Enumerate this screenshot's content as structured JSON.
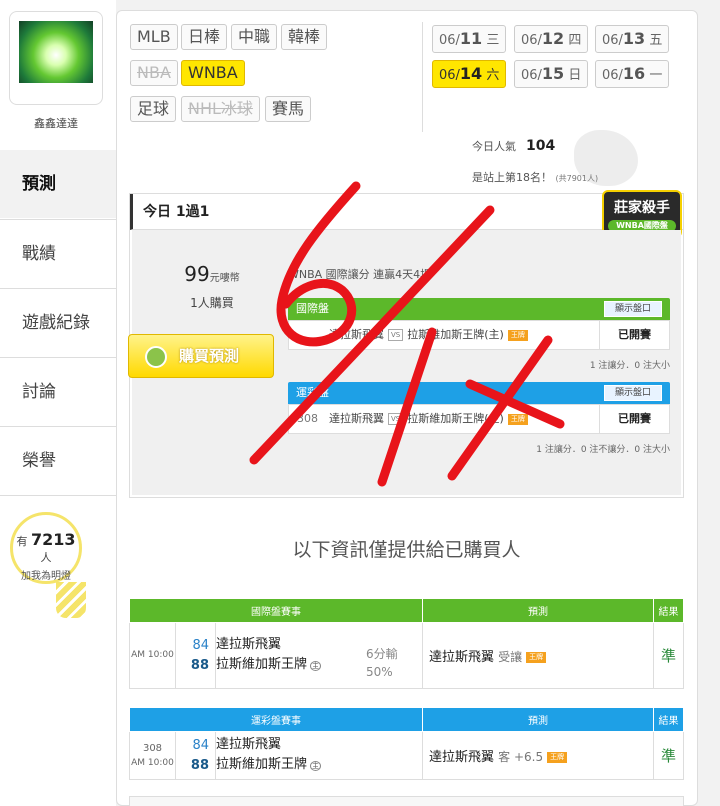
{
  "user": {
    "name": "鑫鑫達達"
  },
  "nav": [
    {
      "label": "預測",
      "active": true
    },
    {
      "label": "戰績"
    },
    {
      "label": "遊戲紀錄"
    },
    {
      "label": "討論"
    },
    {
      "label": "榮譽"
    }
  ],
  "fans": {
    "prefix": "有",
    "count": "7213",
    "suffix": "人",
    "line2": "加我為明燈"
  },
  "leagues": [
    "MLB",
    "日棒",
    "中職",
    "韓棒",
    "NBA",
    "WNBA",
    "足球",
    "NHL冰球",
    "賽馬"
  ],
  "dates": [
    {
      "date": "06/",
      "day": "11",
      "wd": "三"
    },
    {
      "date": "06/",
      "day": "12",
      "wd": "四"
    },
    {
      "date": "06/",
      "day": "13",
      "wd": "五"
    },
    {
      "date": "06/",
      "day": "14",
      "wd": "六"
    },
    {
      "date": "06/",
      "day": "15",
      "wd": "日"
    },
    {
      "date": "06/",
      "day": "16",
      "wd": "一"
    }
  ],
  "popularity": {
    "label": "今日人氣",
    "value": "104"
  },
  "rank": {
    "text": "是站上第18名！",
    "small": "(共7901人)"
  },
  "prediction": {
    "title": "今日 1過1",
    "badge_main": "莊家殺手",
    "badge_sub": "WNBA國際盤",
    "price": "99",
    "price_unit": "元嘍幣",
    "buyers": "1人購買",
    "buy_label": "購買預測",
    "line_info": "WNBA 國際讓分 連贏4天4場",
    "intl": {
      "header": "國際盤",
      "show_btn": "顯示盤口",
      "teams": "達拉斯飛翼",
      "vs": "VS",
      "opp": "拉斯維加斯王牌(主)",
      "mini": "王牌",
      "status": "已開賽",
      "note": "1 注讓分．0 注大小"
    },
    "lottery": {
      "header": "運彩盤",
      "show_btn": "顯示盤口",
      "num": "308",
      "teams": "達拉斯飛翼",
      "vs": "VS",
      "opp": "拉斯維加斯王牌(主)",
      "mini": "王牌",
      "status": "已開賽",
      "note": "1 注讓分．0 注不讓分．0 注大小"
    }
  },
  "notice": "以下資訊僅提供給已購買人",
  "table1": {
    "headers": [
      "國際盤賽事",
      "預測",
      "結果"
    ],
    "time": "AM 10:00",
    "score1": "84",
    "team1": "達拉斯飛翼",
    "score2": "88",
    "team2": "拉斯維加斯王牌",
    "host": "主",
    "margin1": "6分輸",
    "margin2": "50%",
    "pick": "達拉斯飛翼",
    "pick_extra": "受讓",
    "pick_mini": "王牌",
    "result": "準"
  },
  "table2": {
    "headers": [
      "運彩盤賽事",
      "預測",
      "結果"
    ],
    "num": "308",
    "time": "AM 10:00",
    "score1": "84",
    "team1": "達拉斯飛翼",
    "score2": "88",
    "team2": "拉斯維加斯王牌",
    "host": "主",
    "pick": "達拉斯飛翼",
    "pick_extra": "客 +6.5",
    "pick_mini": "王牌",
    "result": "準"
  },
  "annotation": {
    "text": "6/14",
    "color": "#e8141a"
  },
  "colors": {
    "green": "#5cb82a",
    "blue": "#1ea0e6",
    "yellow": "#ffe600"
  }
}
